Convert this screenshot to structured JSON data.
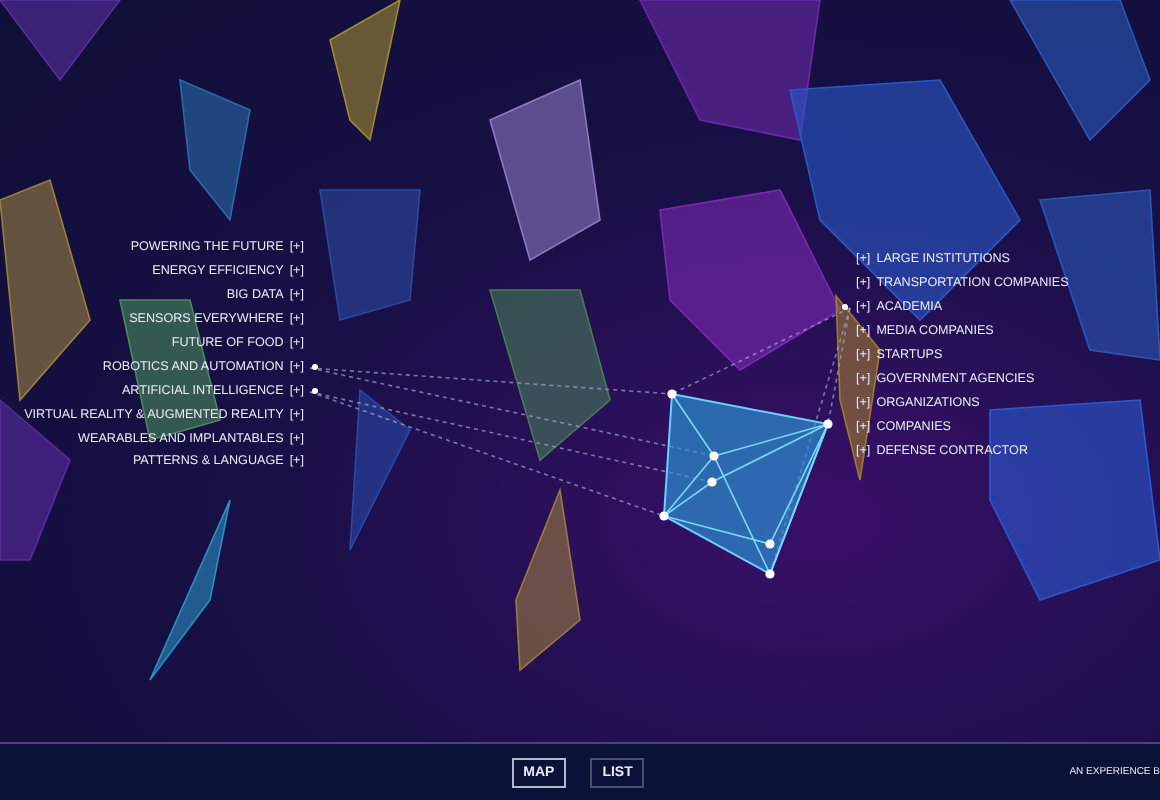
{
  "topics": [
    {
      "label": "POWERING THE FUTURE",
      "toggle": "[+]",
      "connected": false
    },
    {
      "label": "ENERGY EFFICIENCY",
      "toggle": "[+]",
      "connected": false
    },
    {
      "label": "BIG DATA",
      "toggle": "[+]",
      "connected": false
    },
    {
      "label": "SENSORS EVERYWHERE",
      "toggle": "[+]",
      "connected": false
    },
    {
      "label": "FUTURE OF FOOD",
      "toggle": "[+]",
      "connected": false
    },
    {
      "label": "ROBOTICS AND AUTOMATION",
      "toggle": "[+]",
      "connected": true
    },
    {
      "label": "ARTIFICIAL INTELLIGENCE",
      "toggle": "[+]",
      "connected": true
    },
    {
      "label": "VIRTUAL REALITY & AUGMENTED REALITY",
      "toggle": "[+]",
      "connected": false
    },
    {
      "label": "WEARABLES AND IMPLANTABLES",
      "toggle": "[+]",
      "connected": false
    },
    {
      "label": "PATTERNS & LANGUAGE",
      "toggle": "[+]",
      "connected": false
    }
  ],
  "organizations": [
    {
      "label": "LARGE INSTITUTIONS",
      "toggle": "[+]",
      "connected": false
    },
    {
      "label": "TRANSPORTATION COMPANIES",
      "toggle": "[+]",
      "connected": false
    },
    {
      "label": "ACADEMIA",
      "toggle": "[+]",
      "connected": true
    },
    {
      "label": "MEDIA COMPANIES",
      "toggle": "[+]",
      "connected": false
    },
    {
      "label": "STARTUPS",
      "toggle": "[+]",
      "connected": false
    },
    {
      "label": "GOVERNMENT AGENCIES",
      "toggle": "[+]",
      "connected": false
    },
    {
      "label": "ORGANIZATIONS",
      "toggle": "[+]",
      "connected": false
    },
    {
      "label": "COMPANIES",
      "toggle": "[+]",
      "connected": false
    },
    {
      "label": "DEFENSE CONTRACTOR",
      "toggle": "[+]",
      "connected": false
    }
  ],
  "view_tabs": [
    {
      "label": "MAP",
      "selected": true
    },
    {
      "label": "LIST",
      "selected": false
    }
  ],
  "credit": "AN EXPERIENCE B"
}
